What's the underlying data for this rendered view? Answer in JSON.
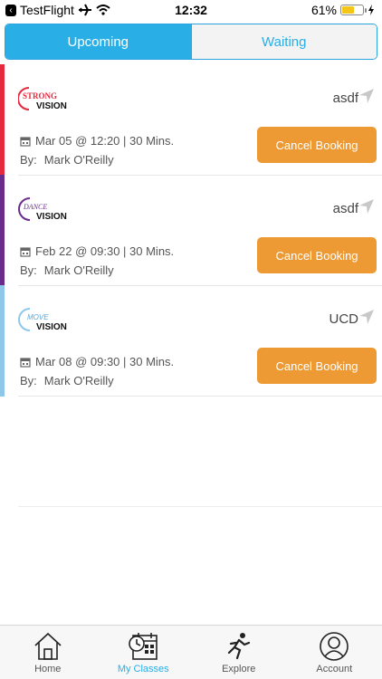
{
  "status_bar": {
    "back_app": "TestFlight",
    "time": "12:32",
    "battery_percent": "61%",
    "battery_level": 0.61
  },
  "tabs": [
    {
      "label": "Upcoming",
      "active": true
    },
    {
      "label": "Waiting",
      "active": false
    }
  ],
  "bookings": [
    {
      "brand": "strong-vision",
      "logo_top": "STRONG",
      "logo_bottom": "VISION",
      "accent": "#e8283c",
      "location": "asdf",
      "when": "Mar 05 @ 12:20 | 30 Mins.",
      "by_label": "By:",
      "instructor": "Mark O'Reilly",
      "cancel_label": "Cancel Booking"
    },
    {
      "brand": "dance-vision",
      "logo_top": "DANCE",
      "logo_bottom": "VISION",
      "accent": "#6a2c8c",
      "location": "asdf",
      "when": "Feb 22 @ 09:30 | 30 Mins.",
      "by_label": "By:",
      "instructor": "Mark O'Reilly",
      "cancel_label": "Cancel Booking"
    },
    {
      "brand": "move-vision",
      "logo_top": "MOVE",
      "logo_bottom": "VISION",
      "accent": "#8ec7ea",
      "location": "UCD",
      "when": "Mar 08 @ 09:30 | 30 Mins.",
      "by_label": "By:",
      "instructor": "Mark O'Reilly",
      "cancel_label": "Cancel Booking"
    }
  ],
  "tabbar": [
    {
      "label": "Home",
      "icon": "home-icon",
      "active": false
    },
    {
      "label": "My Classes",
      "icon": "calendar-clock-icon",
      "active": true
    },
    {
      "label": "Explore",
      "icon": "runner-icon",
      "active": false
    },
    {
      "label": "Account",
      "icon": "user-icon",
      "active": false
    }
  ],
  "colors": {
    "primary": "#29aee6",
    "cancel": "#ed9a35"
  }
}
